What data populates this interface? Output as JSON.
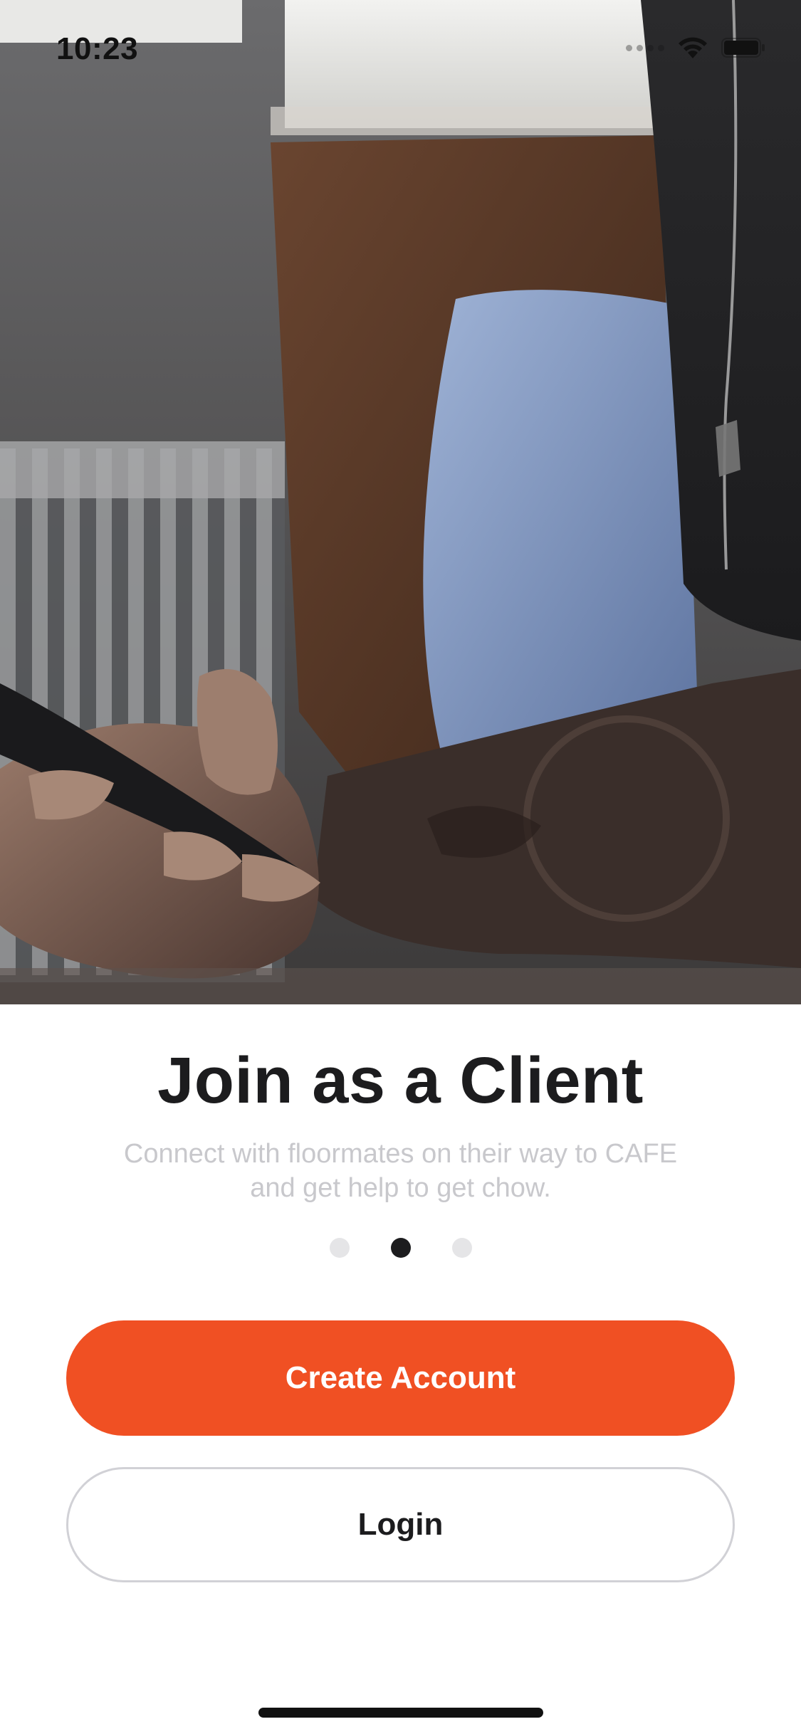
{
  "status_bar": {
    "time": "10:23"
  },
  "hero": {
    "image_description": "photo-person-holding-phone"
  },
  "onboarding": {
    "title": "Join as a Client",
    "subtitle": "Connect with floormates on their way to CAFE and get help to get chow.",
    "page_index": 2,
    "page_count": 3
  },
  "actions": {
    "create_account_label": "Create Account",
    "login_label": "Login"
  },
  "colors": {
    "accent": "#f05023",
    "title": "#1c1c1e",
    "subtitle": "#c8c8cc",
    "dot_inactive": "#e5e5e7",
    "dot_active": "#1c1c1e",
    "button_border": "#d1d1d6"
  }
}
